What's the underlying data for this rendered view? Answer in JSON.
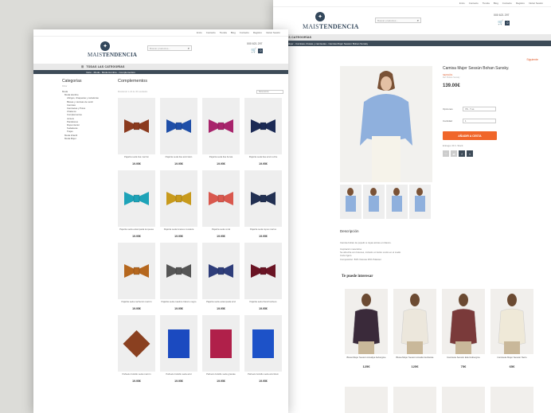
{
  "front": {
    "topbar": [
      "Inicio",
      "Contacto",
      "Tienda",
      "Blog",
      "Contacto",
      "Registro",
      "Iniciar Sesión"
    ],
    "logo": {
      "mais": "MAIS",
      "tendencia": "TENDENCIA"
    },
    "search": {
      "placeholder": "Buscar productos..."
    },
    "phone": "000 621 297",
    "cart": {
      "count": "0"
    },
    "category_bar": "TODAS LAS CATEGORÍAS",
    "breadcrumb": "Inicio - Moda - Moda Hombre - Complementos",
    "sidebar": {
      "title": "Categorías",
      "subtitle": "Filtrar",
      "items": [
        "Moda",
        "Moda Hombre",
        "Abrigos, chaquetas y cazadoras",
        "Blusas y camisas de vestir",
        "Camisas",
        "Camisetas y Polos",
        "Chalecos",
        "Complementos",
        "Jerseis",
        "Pantalones",
        "Ropa interior",
        "Sudaderas",
        "Trajes",
        "Moda Infantil",
        "Moda Mujer"
      ]
    },
    "section_title": "Complementos",
    "result_count": "Mostrando 1–16 de 36 resultados",
    "sort": "Relevancia",
    "products": [
      {
        "name": "Pajarita seda lisa marrón",
        "price": "19.95€",
        "color": "#8b3a1e"
      },
      {
        "name": "Pajarita seda lisa azul klein",
        "price": "19.95€",
        "color": "#1f4fa8"
      },
      {
        "name": "Pajarita seda lisa fucsia",
        "price": "19.95€",
        "color": "#a8246c"
      },
      {
        "name": "Pajarita seda lisa azul noche",
        "price": "19.95€",
        "color": "#1b2a55"
      },
      {
        "name": "Pajarita seda estampada turquesa",
        "price": "19.95€",
        "color": "#1ea3b8"
      },
      {
        "name": "Pajarita seda lunares mostaza",
        "price": "19.95€",
        "color": "#c89a1c"
      },
      {
        "name": "Pajarita seda coral",
        "price": "19.95€",
        "color": "#d9584e"
      },
      {
        "name": "Pajarita seda topos marino",
        "price": "19.95€",
        "color": "#223052"
      },
      {
        "name": "Pajarita seda cachemir marrón",
        "price": "19.95€",
        "color": "#b5671e"
      },
      {
        "name": "Pajarita seda cuadros blanco negro",
        "price": "19.95€",
        "color": "#555555"
      },
      {
        "name": "Pajarita seda estampada azul",
        "price": "19.95€",
        "color": "#2e3d7a"
      },
      {
        "name": "Pajarita seda floral burdeos",
        "price": "19.95€",
        "color": "#6a1424"
      },
      {
        "name": "Pañuelo bolsillo seda marrón",
        "price": "19.95€",
        "color": "#8a4020"
      },
      {
        "name": "Pañuelo bolsillo seda azul",
        "price": "19.95€",
        "color": "#1b4ac0"
      },
      {
        "name": "Pañuelo bolsillo seda granate",
        "price": "19.95€",
        "color": "#b0204a"
      },
      {
        "name": "Pañuelo bolsillo seda azul klein",
        "price": "19.95€",
        "color": "#1d52c8"
      }
    ]
  },
  "back": {
    "topbar": [
      "Inicio",
      "Contacto",
      "Tienda",
      "Blog",
      "Contacto",
      "Registro",
      "Iniciar Sesión"
    ],
    "logo": {
      "mais": "MAIS",
      "tendencia": "TENDENCIA"
    },
    "search": {
      "placeholder": "Buscar productos..."
    },
    "phone": "000 621 297",
    "cart": {
      "count": "0"
    },
    "category_bar": "TODAS LAS CATEGORÍAS",
    "breadcrumb": "Inicio - Moda Mujer - Camisas, blusas y camisetas - Camisa Mujer Sessùn Bohan Sunsky",
    "next_link": "Siguiente",
    "product": {
      "title": "Camisa Mujer Sessùn Bohan Sunsky.",
      "brand": "SESSÙN",
      "ref": "Ref: Bohan Sunsky",
      "price": "139.00€",
      "size_label": "Opciones",
      "size_value": "XS - T-xs",
      "qty_label": "Cantidad",
      "qty_value": "1",
      "add_button": "AÑADIR A CESTA",
      "availability": "Entrega: 24 h. Stock"
    },
    "description": {
      "title": "Descripción",
      "text": "Camisa bohan de popelín a rayas azules en blanco.",
      "bullets": [
        "Inspiración masculina",
        "Se abrocha con botones, incluido un botón oculto en el cuello",
        "Corte ligero",
        "Composición: 84% Viscosa 16% Poliéster"
      ]
    },
    "related": {
      "title": "Te puede interesar",
      "items": [
        {
          "name": "Blusa Mujer Sessùn Amaltya Aubergine",
          "price": "125€"
        },
        {
          "name": "Blusa Mujer Sessùn Amalia Guirlande",
          "price": "125€"
        },
        {
          "name": "Camiseta Sessùn Edel Aubergine",
          "price": "75€"
        },
        {
          "name": "Camiseta Mujer Sessùn Nerio",
          "price": "65€"
        }
      ]
    }
  }
}
